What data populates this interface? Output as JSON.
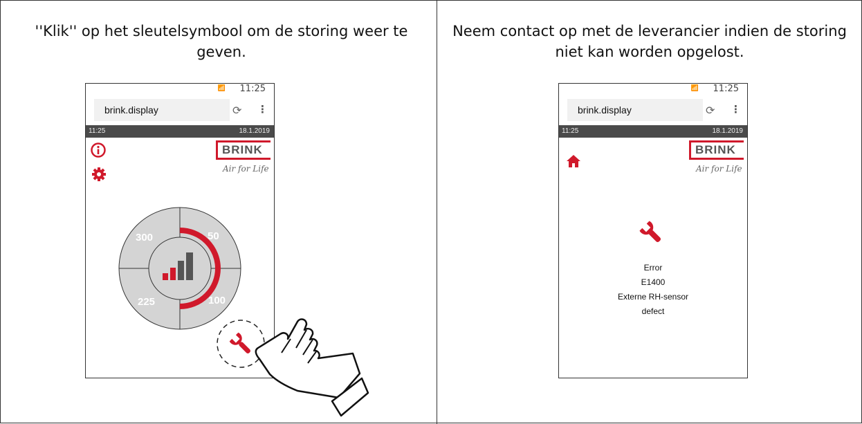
{
  "panels": {
    "left_caption": "''Klik'' op het sleutelsymbool om de storing weer te geven.",
    "right_caption": "Neem contact op met de leverancier indien de storing niet kan worden opgelost."
  },
  "phone_left": {
    "status_time": "11:25",
    "url": "brink.display",
    "bar_time": "11:25",
    "bar_date": "18.1.2019",
    "brand": "BRINK",
    "slogan": "Air for Life",
    "dial": {
      "top_left": "300",
      "top_right": "50",
      "bottom_left": "225",
      "bottom_right": "100"
    }
  },
  "phone_right": {
    "status_time": "11:25",
    "url": "brink.display",
    "bar_time": "11:25",
    "bar_date": "18.1.2019",
    "brand": "BRINK",
    "slogan": "Air for Life",
    "error": {
      "title": "Error",
      "code": "E1400",
      "description": "Externe RH-sensor",
      "state": "defect"
    }
  },
  "colors": {
    "accent": "#d0192b",
    "dial": "#d4d4d4",
    "bar": "#4a4a4a"
  },
  "icons": [
    "info-icon",
    "gear-icon",
    "wrench-icon",
    "home-icon",
    "reload-icon",
    "menu-dots-icon",
    "hand-pointer-icon"
  ]
}
